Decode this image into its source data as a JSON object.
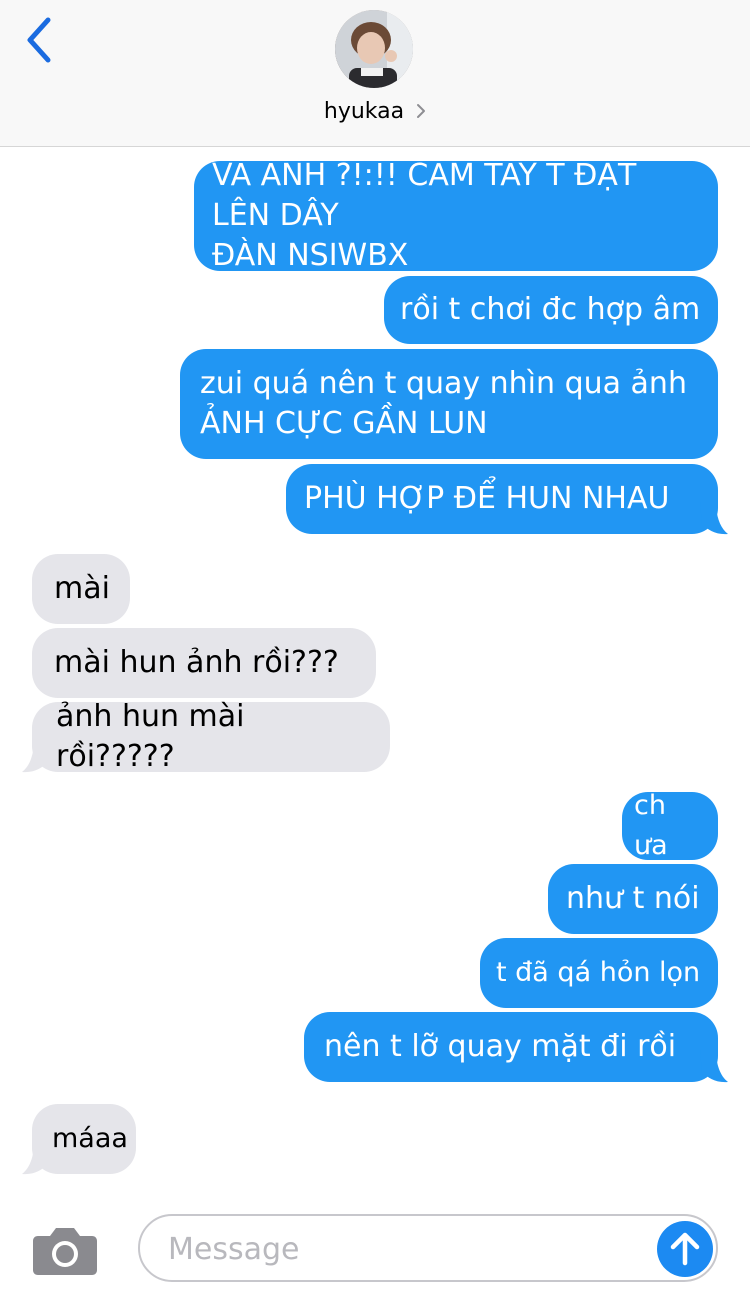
{
  "header": {
    "contact_name": "hyukaa",
    "back_icon": "chevron-left-icon",
    "accent_color": "#1a6be0"
  },
  "messages": [
    {
      "side": "out",
      "text": "VÀ ẢNH ?!:!! CẦM TAY T ĐẶT LÊN DÂY\nĐÀN NSIWBX"
    },
    {
      "side": "out",
      "text": "rồi t chơi đc hợp âm"
    },
    {
      "side": "out",
      "text": "zui quá nên t quay nhìn qua ảnh\nẢNH CỰC GẦN LUN"
    },
    {
      "side": "out",
      "text": "PHÙ HỢP ĐỂ HUN NHAU"
    },
    {
      "side": "in",
      "text": "mài"
    },
    {
      "side": "in",
      "text": "mài hun ảnh rồi???"
    },
    {
      "side": "in",
      "text": "ảnh hun mài rồi?????"
    },
    {
      "side": "out",
      "text": "ch ưa"
    },
    {
      "side": "out",
      "text": "như t nói"
    },
    {
      "side": "out",
      "text": "t đã qá hỏn lọn"
    },
    {
      "side": "out",
      "text": "nên t lỡ quay mặt đi rồi"
    },
    {
      "side": "in",
      "text": "máaa"
    }
  ],
  "composer": {
    "placeholder": "Message",
    "camera_icon": "camera-icon",
    "send_icon": "arrow-up-icon"
  },
  "colors": {
    "outgoing": "#2196f3",
    "incoming": "#e5e5ea",
    "send_button": "#1c8af2"
  }
}
